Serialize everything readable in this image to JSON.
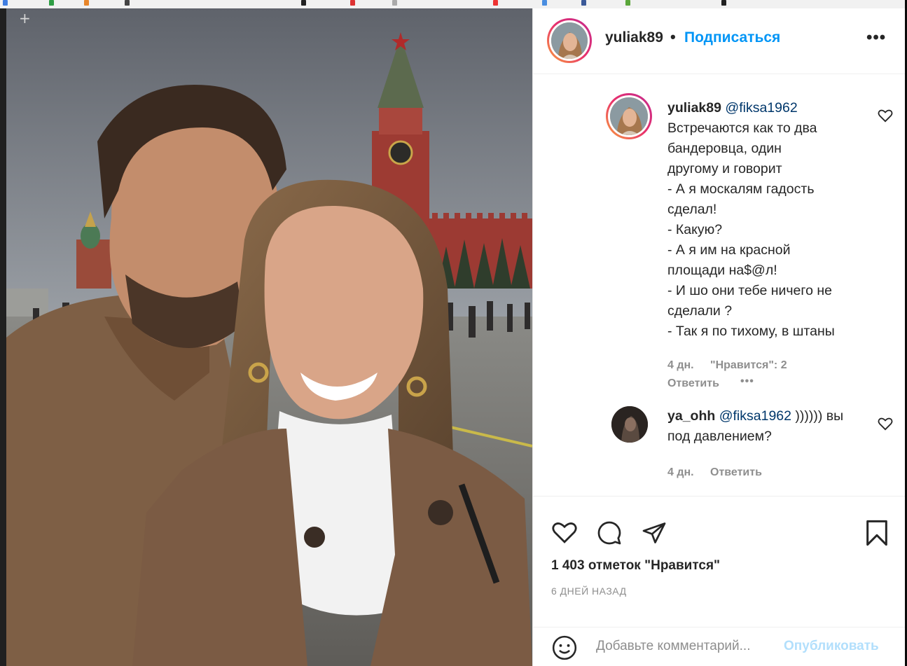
{
  "post_header": {
    "username": "yuliak89",
    "separator": "•",
    "follow_label": "Подписаться",
    "more_label": "•••"
  },
  "comments": [
    {
      "username": "yuliak89",
      "mention": "@fiksa1962",
      "lines": [
        "Встречаются как то два",
        "бандеровца, один",
        "другому и говорит",
        "- А я москалям гадость",
        "сделал!",
        "- Какую?",
        "- А я им на красной",
        "площади на$@л!",
        "- И шо они тебе ничего не",
        "сделали ?",
        "- Так я по тихому, в штаны"
      ],
      "time": "4 дн.",
      "likes": "\"Нравится\": 2",
      "reply": "Ответить",
      "more": "•••"
    },
    {
      "username": "ya_ohh",
      "mention": "@fiksa1962",
      "text_after_mention": " )))))) вы",
      "line2": "под давлением?",
      "time": "4 дн.",
      "reply": "Ответить"
    }
  ],
  "likes_count_text": "1 403 отметок \"Нравится\"",
  "posted_ago": "6 ДНЕЙ НАЗАД",
  "add_comment": {
    "placeholder": "Добавьте комментарий...",
    "publish_label": "Опубликовать"
  },
  "photo_overlay": "+",
  "colors": {
    "accent": "#0095f6",
    "mention": "#00376b",
    "muted": "#8e8e8e",
    "text": "#262626"
  },
  "icons": [
    "heart-icon",
    "comment-icon",
    "share-icon",
    "bookmark-icon",
    "emoji-icon",
    "more-icon"
  ]
}
